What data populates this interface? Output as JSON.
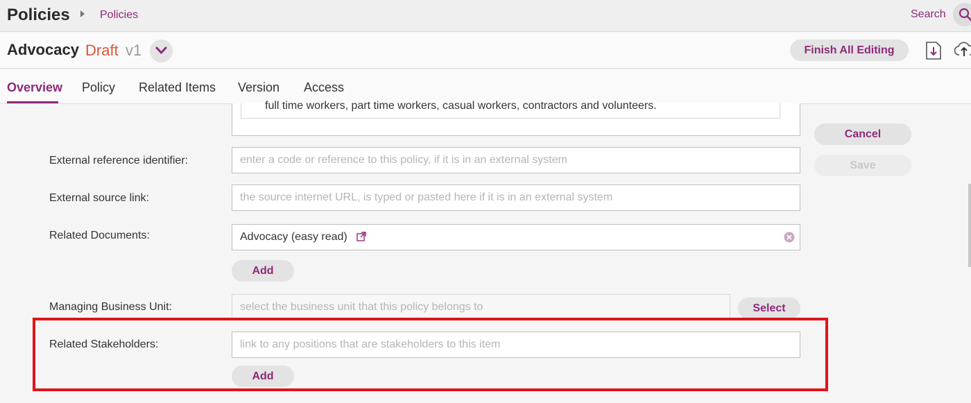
{
  "header": {
    "app_title": "Policies",
    "breadcrumb": "Policies",
    "search_label": "Search"
  },
  "document": {
    "name": "Advocacy",
    "status": "Draft",
    "version": "v1",
    "finish_label": "Finish All Editing"
  },
  "tabs": [
    {
      "label": "Overview"
    },
    {
      "label": "Policy"
    },
    {
      "label": "Related Items"
    },
    {
      "label": "Version"
    },
    {
      "label": "Access"
    }
  ],
  "form": {
    "description_text": "full time workers, part time workers, casual workers, contractors and volunteers.",
    "external_ref": {
      "label": "External reference identifier:",
      "value": "",
      "placeholder": "enter a code or reference to this policy, if it is in an external system"
    },
    "external_link": {
      "label": "External source link:",
      "value": "",
      "placeholder": "the source internet URL, is typed or pasted here if it is in an external system"
    },
    "related_documents": {
      "label": "Related Documents:",
      "items": [
        "Advocacy (easy read)"
      ],
      "add_label": "Add"
    },
    "managing_unit": {
      "label": "Managing Business Unit:",
      "value": "",
      "placeholder": "select the business unit that this policy belongs to",
      "select_label": "Select"
    },
    "related_stakeholders": {
      "label": "Related Stakeholders:",
      "value": "",
      "placeholder": "link to any positions that are stakeholders to this item",
      "add_label": "Add"
    }
  },
  "actions": {
    "cancel_label": "Cancel",
    "save_label": "Save"
  },
  "colors": {
    "accent": "#8e2a7a",
    "draft": "#e05538",
    "highlight": "#e0141b"
  }
}
